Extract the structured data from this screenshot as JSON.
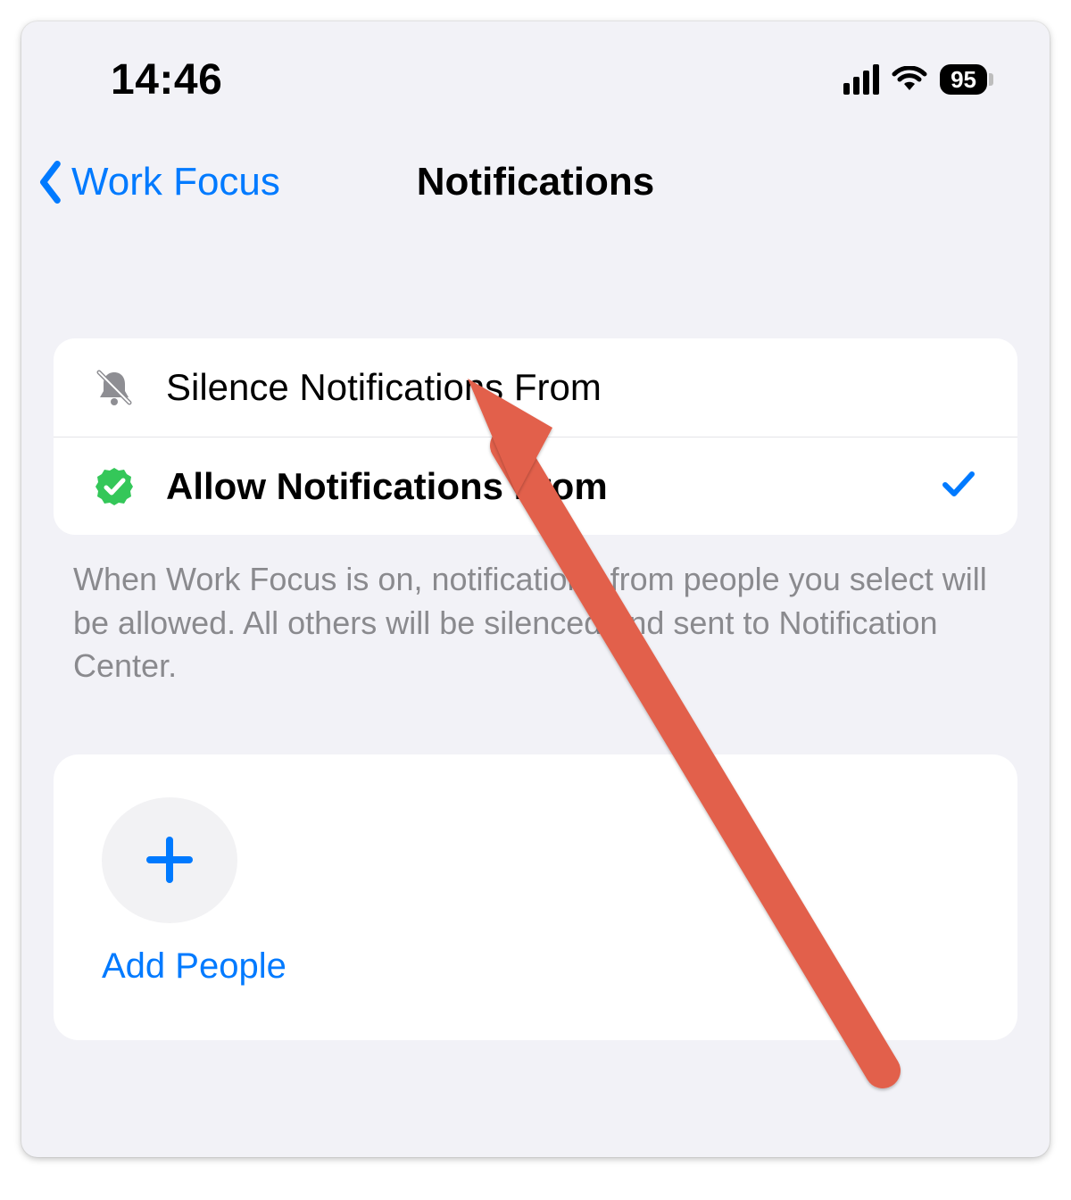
{
  "statusbar": {
    "time": "14:46",
    "battery_level": "95"
  },
  "navbar": {
    "back_label": "Work Focus",
    "title": "Notifications"
  },
  "options": {
    "silence_label": "Silence Notifications From",
    "allow_label": "Allow Notifications From",
    "selected": "allow"
  },
  "footer_note": "When Work Focus is on, notifications from people you select will be allowed. All others will be silenced and sent to Notification Center.",
  "add_people": {
    "label": "Add People"
  },
  "colors": {
    "ios_blue": "#007aff",
    "ios_gray_bg": "#f2f2f7",
    "ios_green": "#34c759",
    "annotation_red": "#e2614c"
  }
}
